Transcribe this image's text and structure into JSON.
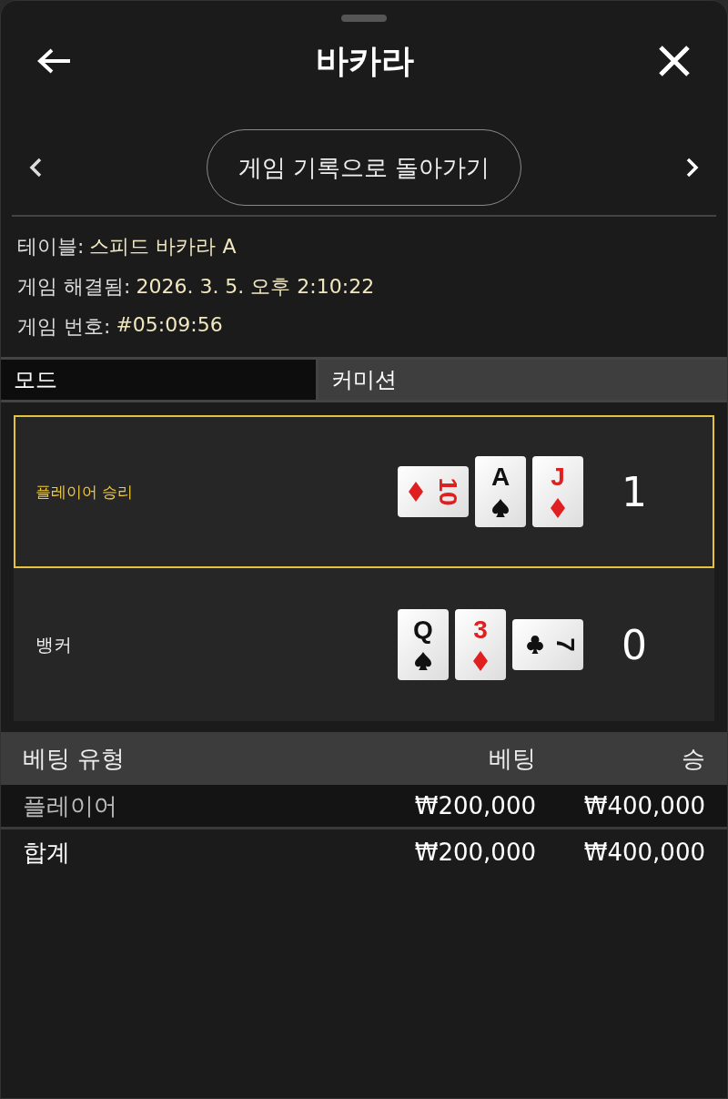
{
  "header": {
    "title": "바카라",
    "back_label": "게임 기록으로 돌아가기"
  },
  "info": [
    {
      "label": "테이블:",
      "value": "스피드 바카라 A"
    },
    {
      "label": "게임 해결됨:",
      "value": "2026. 3. 5. 오후 2:10:22"
    },
    {
      "label": "게임 번호:",
      "value": "#05:09:56"
    }
  ],
  "mode": {
    "label": "모드",
    "value": "커미션"
  },
  "hands": [
    {
      "name": "플레이어 승리",
      "winner": true,
      "score": "1",
      "cards": [
        {
          "rank": "10",
          "kind": "diamond",
          "rotated": true
        },
        {
          "rank": "A",
          "kind": "spade",
          "rotated": false
        },
        {
          "rank": "J",
          "kind": "diamond",
          "rotated": false
        }
      ]
    },
    {
      "name": "뱅커",
      "winner": false,
      "score": "0",
      "cards": [
        {
          "rank": "Q",
          "kind": "spade",
          "rotated": false
        },
        {
          "rank": "3",
          "kind": "diamond",
          "rotated": false
        },
        {
          "rank": "7",
          "kind": "club",
          "rotated": true
        }
      ]
    }
  ],
  "bets": {
    "columns": [
      "베팅 유형",
      "베팅",
      "승"
    ],
    "rows": [
      {
        "kind": "bet",
        "cells": [
          "플레이어",
          "₩200,000",
          "₩400,000"
        ]
      },
      {
        "kind": "total",
        "cells": [
          "합계",
          "₩200,000",
          "₩400,000"
        ]
      }
    ]
  }
}
